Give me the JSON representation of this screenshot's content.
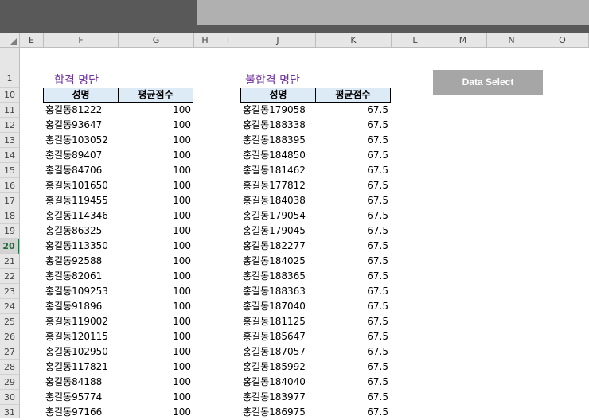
{
  "columns": [
    "E",
    "F",
    "G",
    "H",
    "I",
    "J",
    "K",
    "L",
    "M",
    "N",
    "O"
  ],
  "row_headers": [
    "1",
    "10",
    "11",
    "12",
    "13",
    "14",
    "15",
    "16",
    "17",
    "18",
    "19",
    "20",
    "21",
    "22",
    "23",
    "24",
    "25",
    "26",
    "27",
    "28",
    "29",
    "30",
    "31"
  ],
  "active_row": "20",
  "pass_list": {
    "title": "합격 명단",
    "headers": [
      "성명",
      "평균점수"
    ],
    "rows": [
      [
        "홍길동81222",
        "100"
      ],
      [
        "홍길동93647",
        "100"
      ],
      [
        "홍길동103052",
        "100"
      ],
      [
        "홍길동89407",
        "100"
      ],
      [
        "홍길동84706",
        "100"
      ],
      [
        "홍길동101650",
        "100"
      ],
      [
        "홍길동119455",
        "100"
      ],
      [
        "홍길동114346",
        "100"
      ],
      [
        "홍길동86325",
        "100"
      ],
      [
        "홍길동113350",
        "100"
      ],
      [
        "홍길동92588",
        "100"
      ],
      [
        "홍길동82061",
        "100"
      ],
      [
        "홍길동109253",
        "100"
      ],
      [
        "홍길동91896",
        "100"
      ],
      [
        "홍길동119002",
        "100"
      ],
      [
        "홍길동120115",
        "100"
      ],
      [
        "홍길동102950",
        "100"
      ],
      [
        "홍길동117821",
        "100"
      ],
      [
        "홍길동84188",
        "100"
      ],
      [
        "홍길동95774",
        "100"
      ],
      [
        "홍길동97166",
        "100"
      ]
    ]
  },
  "fail_list": {
    "title": "불합격 명단",
    "headers": [
      "성명",
      "평균점수"
    ],
    "rows": [
      [
        "홍길동179058",
        "67.5"
      ],
      [
        "홍길동188338",
        "67.5"
      ],
      [
        "홍길동188395",
        "67.5"
      ],
      [
        "홍길동184850",
        "67.5"
      ],
      [
        "홍길동181462",
        "67.5"
      ],
      [
        "홍길동177812",
        "67.5"
      ],
      [
        "홍길동184038",
        "67.5"
      ],
      [
        "홍길동179054",
        "67.5"
      ],
      [
        "홍길동179045",
        "67.5"
      ],
      [
        "홍길동182277",
        "67.5"
      ],
      [
        "홍길동184025",
        "67.5"
      ],
      [
        "홍길동188365",
        "67.5"
      ],
      [
        "홍길동188363",
        "67.5"
      ],
      [
        "홍길동187040",
        "67.5"
      ],
      [
        "홍길동181125",
        "67.5"
      ],
      [
        "홍길동185647",
        "67.5"
      ],
      [
        "홍길동187057",
        "67.5"
      ],
      [
        "홍길동185992",
        "67.5"
      ],
      [
        "홍길동184040",
        "67.5"
      ],
      [
        "홍길동183977",
        "67.5"
      ],
      [
        "홍길동186975",
        "67.5"
      ]
    ]
  },
  "button": {
    "label": "Data Select"
  }
}
